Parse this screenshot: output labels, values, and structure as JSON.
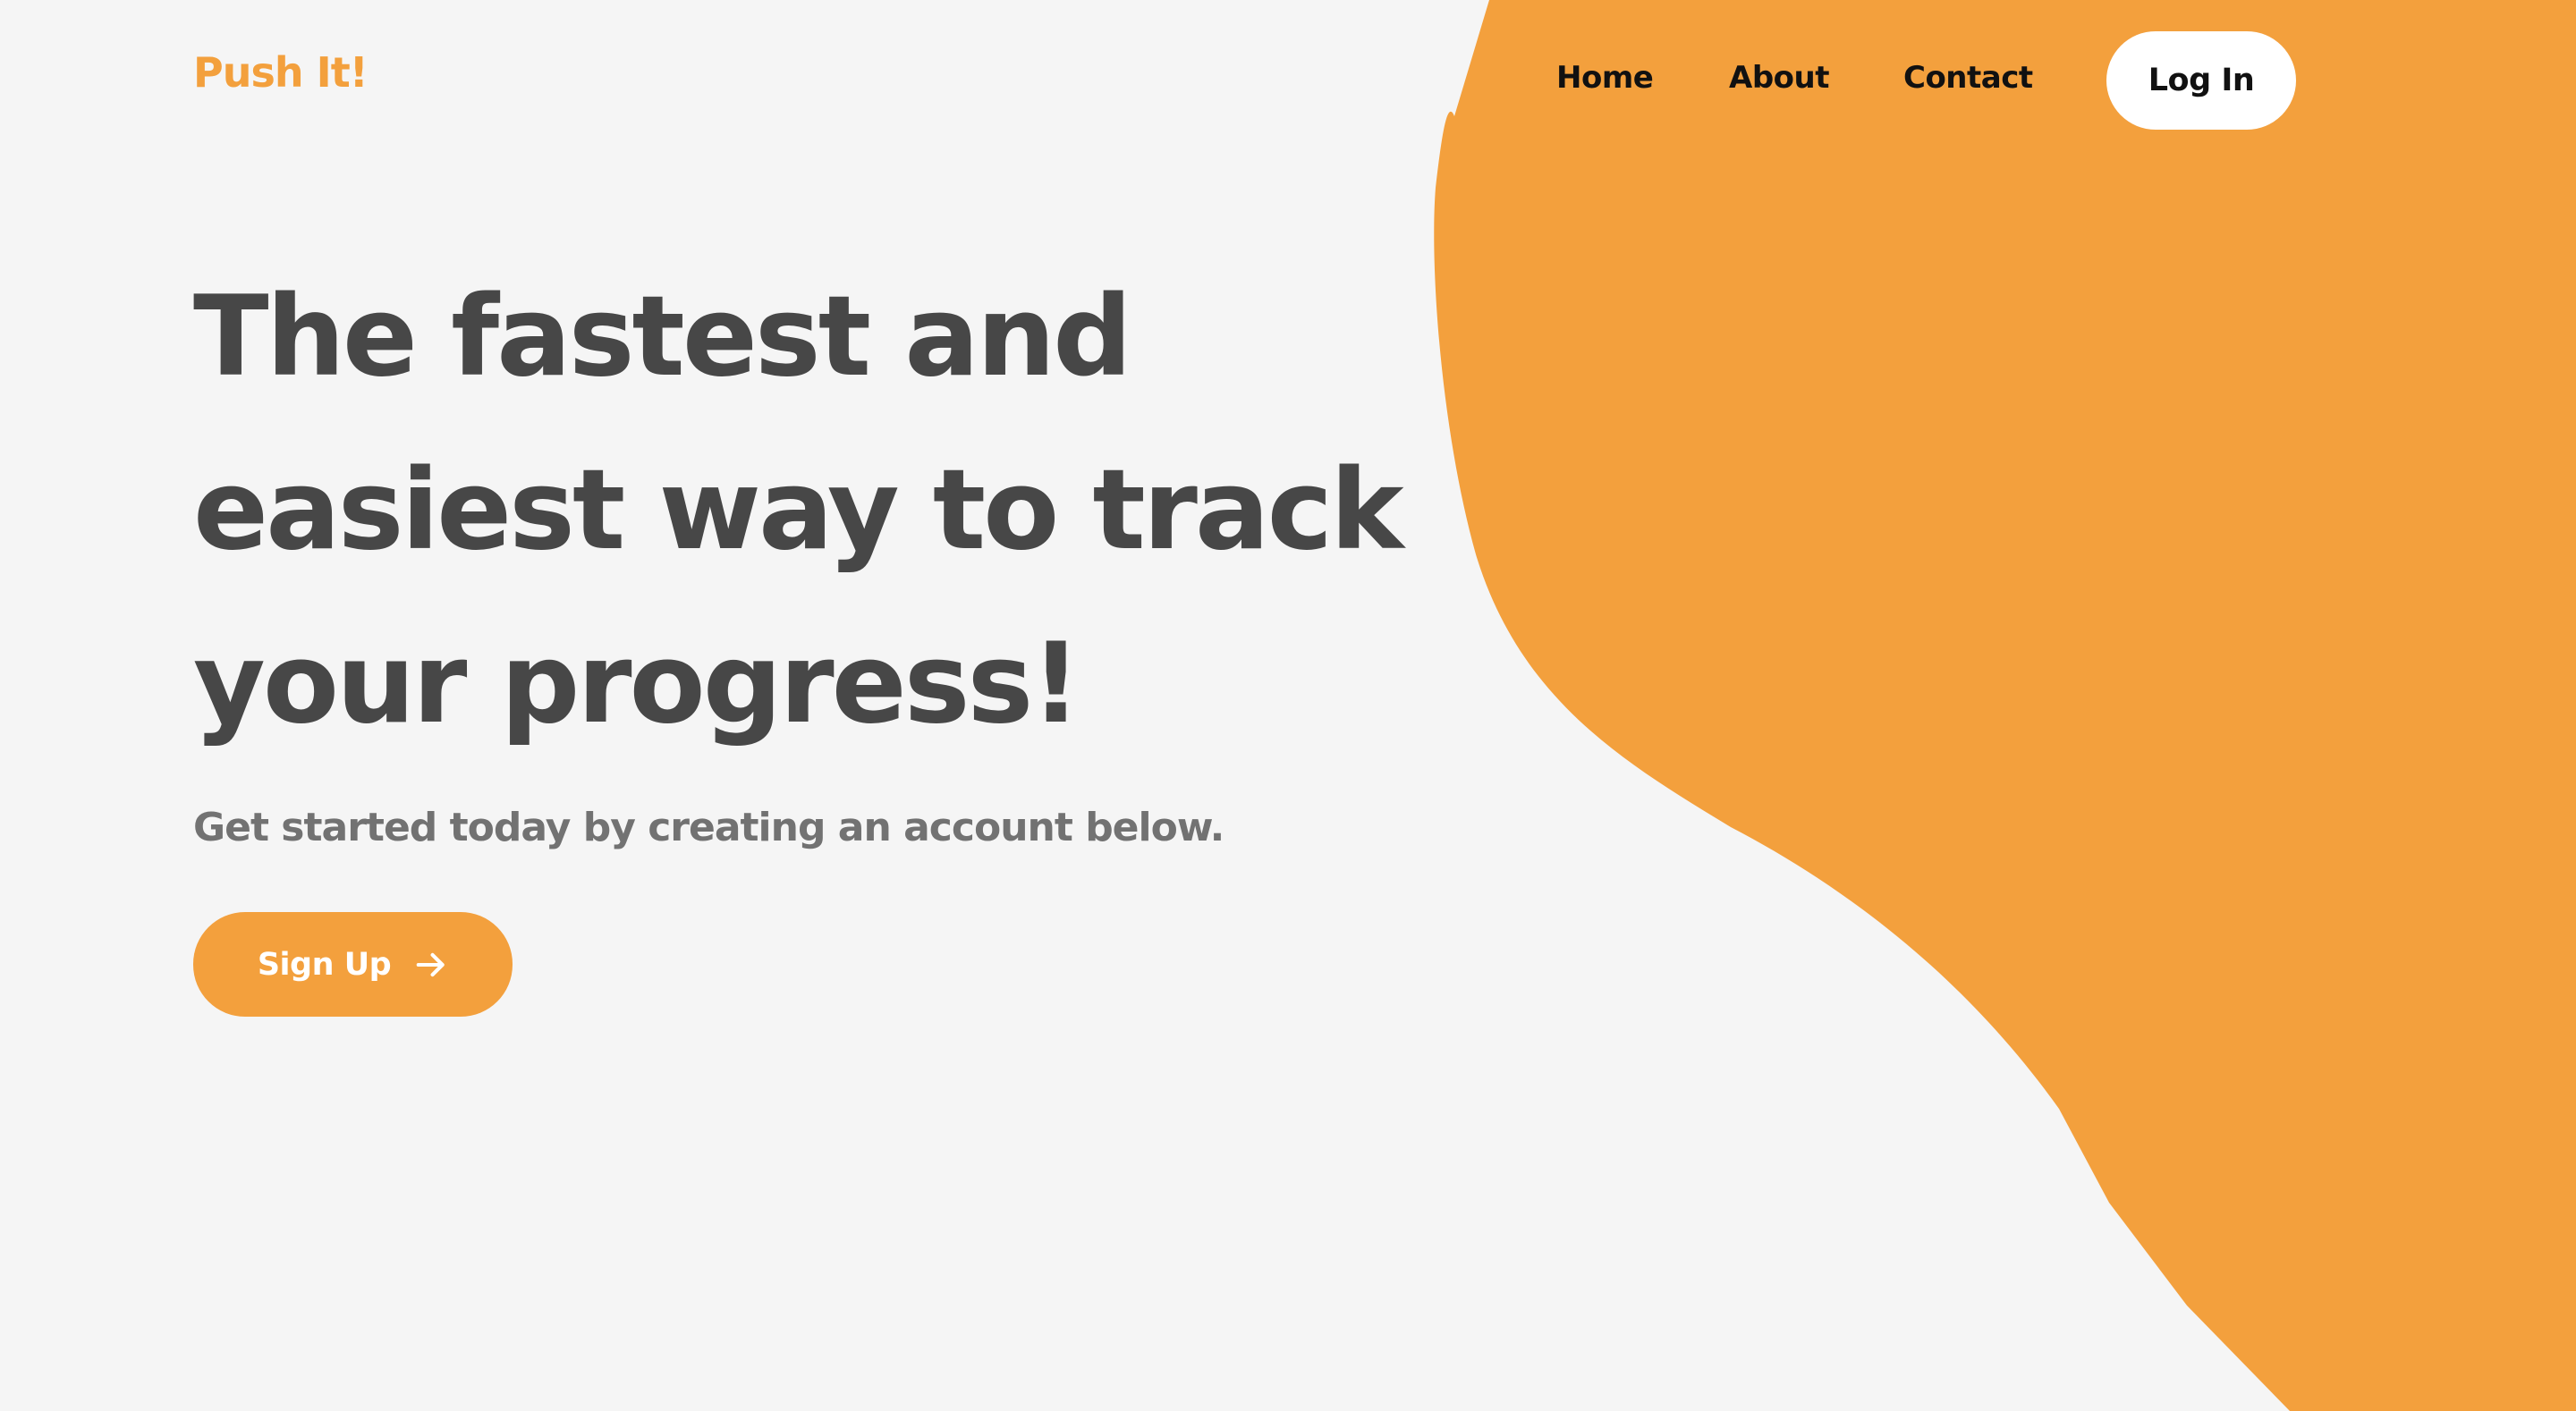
{
  "brand": {
    "name": "Push It!",
    "accent_color": "#f3a03d"
  },
  "nav": {
    "links": [
      {
        "label": "Home"
      },
      {
        "label": "About"
      },
      {
        "label": "Contact"
      }
    ],
    "login_label": "Log In"
  },
  "hero": {
    "headline_lines": [
      "The fastest and",
      "easiest way to track",
      "your progress!"
    ],
    "subtitle": "Get started today by creating an account below.",
    "signup_label": "Sign Up",
    "signup_icon": "arrow-right-icon"
  },
  "colors": {
    "background": "#f5f5f5",
    "accent": "#f3a03d",
    "headline": "#474747",
    "subtitle": "#727272",
    "nav_text": "#111111",
    "login_background": "#ffffff"
  }
}
